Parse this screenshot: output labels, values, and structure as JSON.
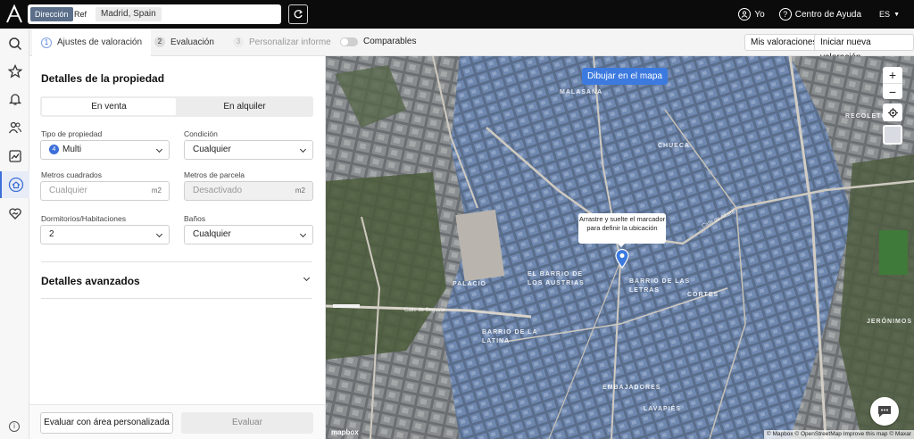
{
  "topbar": {
    "search": {
      "mode_address": "Dirección",
      "mode_ref": "Ref",
      "query": "Madrid, Spain"
    },
    "user_label": "Yo",
    "help_label": "Centro de Ayuda",
    "language": "ES"
  },
  "rail": {
    "items": [
      "search",
      "favorites",
      "notifications",
      "users",
      "analytics",
      "valuation",
      "deals"
    ],
    "active": "valuation"
  },
  "steps": [
    {
      "num": "1",
      "label": "Ajustes de valoración",
      "state": "active"
    },
    {
      "num": "2",
      "label": "Evaluación",
      "state": "normal"
    },
    {
      "num": "3",
      "label": "Personalizar informe",
      "state": "disabled"
    }
  ],
  "comparables_label": "Comparables",
  "header_buttons": {
    "my_valuations": "Mis valoraciones",
    "new_valuation": "Iniciar nueva valoración"
  },
  "panel": {
    "title": "Detalles de la propiedad",
    "segment": {
      "sale": "En venta",
      "rent": "En alquiler",
      "selected": "sale"
    },
    "fields": {
      "property_type": {
        "label": "Tipo de propiedad",
        "value": "Multi",
        "badge": "4"
      },
      "condition": {
        "label": "Condición",
        "value": "Cualquier"
      },
      "sqm": {
        "label": "Metros cuadrados",
        "placeholder": "Cualquier",
        "unit": "m2"
      },
      "plot": {
        "label": "Metros de parcela",
        "placeholder": "Desactivado",
        "unit": "m2"
      },
      "bedrooms": {
        "label": "Dormitorios/Habitaciones",
        "value": "2"
      },
      "bathrooms": {
        "label": "Baños",
        "value": "Cualquier"
      }
    },
    "advanced_title": "Detalles avanzados",
    "footer": {
      "custom_area": "Evaluar con área personalizada",
      "evaluate": "Evaluar"
    }
  },
  "map": {
    "draw_button": "Dibujar en el mapa",
    "tooltip": "Arrastre y suelte el marcador para definir la ubicación",
    "labels": {
      "chueca": "CHUECA",
      "recoletos": "RECOLETOS",
      "malasana": "MALASAÑA",
      "austrias": "EL BARRIO DE LOS AUSTRIAS",
      "letras": "BARRIO DE LAS LETRAS",
      "cortes": "CORTES",
      "palacio": "PALACIO",
      "latina": "BARRIO DE LA LATINA",
      "jeronimos": "JERÓNIMOS",
      "embajadores": "EMBAJADORES",
      "lavapies": "LAVAPIÉS"
    },
    "streets": {
      "segovia": "Calle de Segovia",
      "alcala": "Calle de Alcalá"
    },
    "attribution": "© Mapbox © OpenStreetMap Improve this map © Maxar",
    "logo": "mapbox"
  },
  "colors": {
    "accent": "#3c6fd8",
    "topbar": "#0b0b0b",
    "draw_button": "#3c7ae0"
  }
}
